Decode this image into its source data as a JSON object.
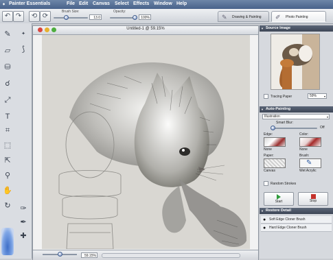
{
  "menubar": {
    "app_name": "Painter Essentials",
    "items": [
      "File",
      "Edit",
      "Canvas",
      "Select",
      "Effects",
      "Window",
      "Help"
    ]
  },
  "propbar": {
    "brush_size_label": "Brush Size:",
    "brush_size_value": "13.0",
    "brush_size_level": 0.35,
    "opacity_label": "Opacity:",
    "opacity_value": "100%",
    "opacity_level": 1.0,
    "workspace_tabs": [
      "Drawing & Painting",
      "Photo Painting"
    ],
    "active_tab": "Photo Painting"
  },
  "document": {
    "title": "Untitled-1 @ 59.15%",
    "zoom": "59.15%"
  },
  "source_image": {
    "header": "Source Image",
    "tracing_paper_label": "Tracing Paper",
    "tracing_zoom": "59%"
  },
  "auto_painting": {
    "header": "Auto-Painting",
    "style": "Illustration",
    "smart_blur_label": "Smart Blur:",
    "smart_blur_value": "Off",
    "edge_label": "Edge:",
    "edge_value": "None",
    "color_label": "Color:",
    "color_value": "None",
    "paper_label": "Paper:",
    "paper_value": "Canvas",
    "brush_label": "Brush:",
    "brush_value": "Wet Acrylic",
    "random_strokes_label": "Random Strokes",
    "start_label": "Start",
    "stop_label": "Stop"
  },
  "restore_detail": {
    "header": "Restore Detail",
    "items": [
      "Soft Edge Cloner Brush",
      "Hard Edge Cloner Brush"
    ]
  },
  "colors": {
    "menubar": "#5a7399",
    "panel_header": "#4a5366",
    "start_green": "#2e9b3a",
    "stop_red": "#c4312b"
  }
}
